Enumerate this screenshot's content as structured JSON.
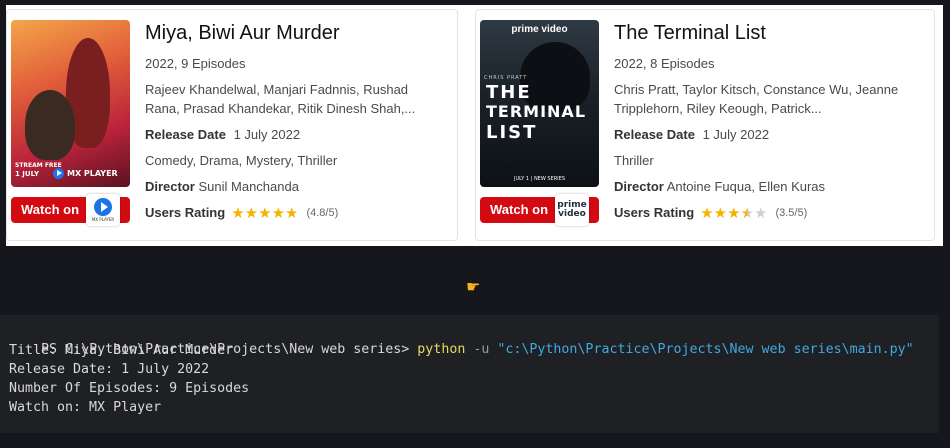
{
  "cards": [
    {
      "title": "Miya, Biwi Aur Murder",
      "subtitle": "2022, 9 Episodes",
      "cast": "Rajeev Khandelwal, Manjari Fadnnis, Rushad Rana, Prasad Khandekar, Ritik Dinesh Shah,...",
      "release_label": "Release Date",
      "release_value": "1 July 2022",
      "genres": "Comedy, Drama, Mystery, Thriller",
      "director_label": "Director",
      "director_value": "Sunil Manchanda",
      "rating_label": "Users Rating",
      "rating_value": 4.8,
      "rating_text": "(4.8/5)",
      "watch_label": "Watch on",
      "provider_small": "MX PLAYER",
      "poster_tag_1": "STREAM FREE",
      "poster_tag_2": "1 JULY",
      "poster_brand": "MX PLAYER",
      "provider_color": "#1a73e8"
    },
    {
      "title": "The Terminal List",
      "subtitle": "2022, 8 Episodes",
      "cast": "Chris Pratt, Taylor Kitsch, Constance Wu, Jeanne Tripplehorn, Riley Keough, Patrick...",
      "release_label": "Release Date",
      "release_value": "1 July 2022",
      "genres": "Thriller",
      "director_label": "Director",
      "director_value": "Antoine Fuqua, Ellen Kuras",
      "rating_label": "Users Rating",
      "rating_value": 3.5,
      "rating_text": "(3.5/5)",
      "watch_label": "Watch on",
      "provider_line1": "prime",
      "provider_line2": "video",
      "poster_brand": "prime video",
      "poster_actor": "CHRIS PRATT",
      "poster_title_1": "THE",
      "poster_title_2": "TERMINAL",
      "poster_title_3": "LIST",
      "poster_footer": "JULY 1 | NEW SERIES",
      "provider_color": "#00a8e1"
    }
  ],
  "terminal": {
    "prompt": "PS C:\\Python\\Practice\\Projects\\New web series> ",
    "command": "python",
    "flag": " -u ",
    "arg": "\"c:\\Python\\Practice\\Projects\\New web series\\main.py\"",
    "output": [
      "Title: Miya, Biwi Aur Murder",
      "Release Date: 1 July 2022",
      "Number Of Episodes: 9 Episodes",
      "Watch on: MX Player"
    ]
  },
  "icons": {
    "cursor": "pointer-hand-icon",
    "star": "star-icon",
    "play": "play-icon"
  },
  "colors": {
    "watch_bar": "#d40a12",
    "star": "#f5b301",
    "terminal_bg": "#1e2024",
    "command": "#e6d86a",
    "argument": "#3fa9e0"
  }
}
